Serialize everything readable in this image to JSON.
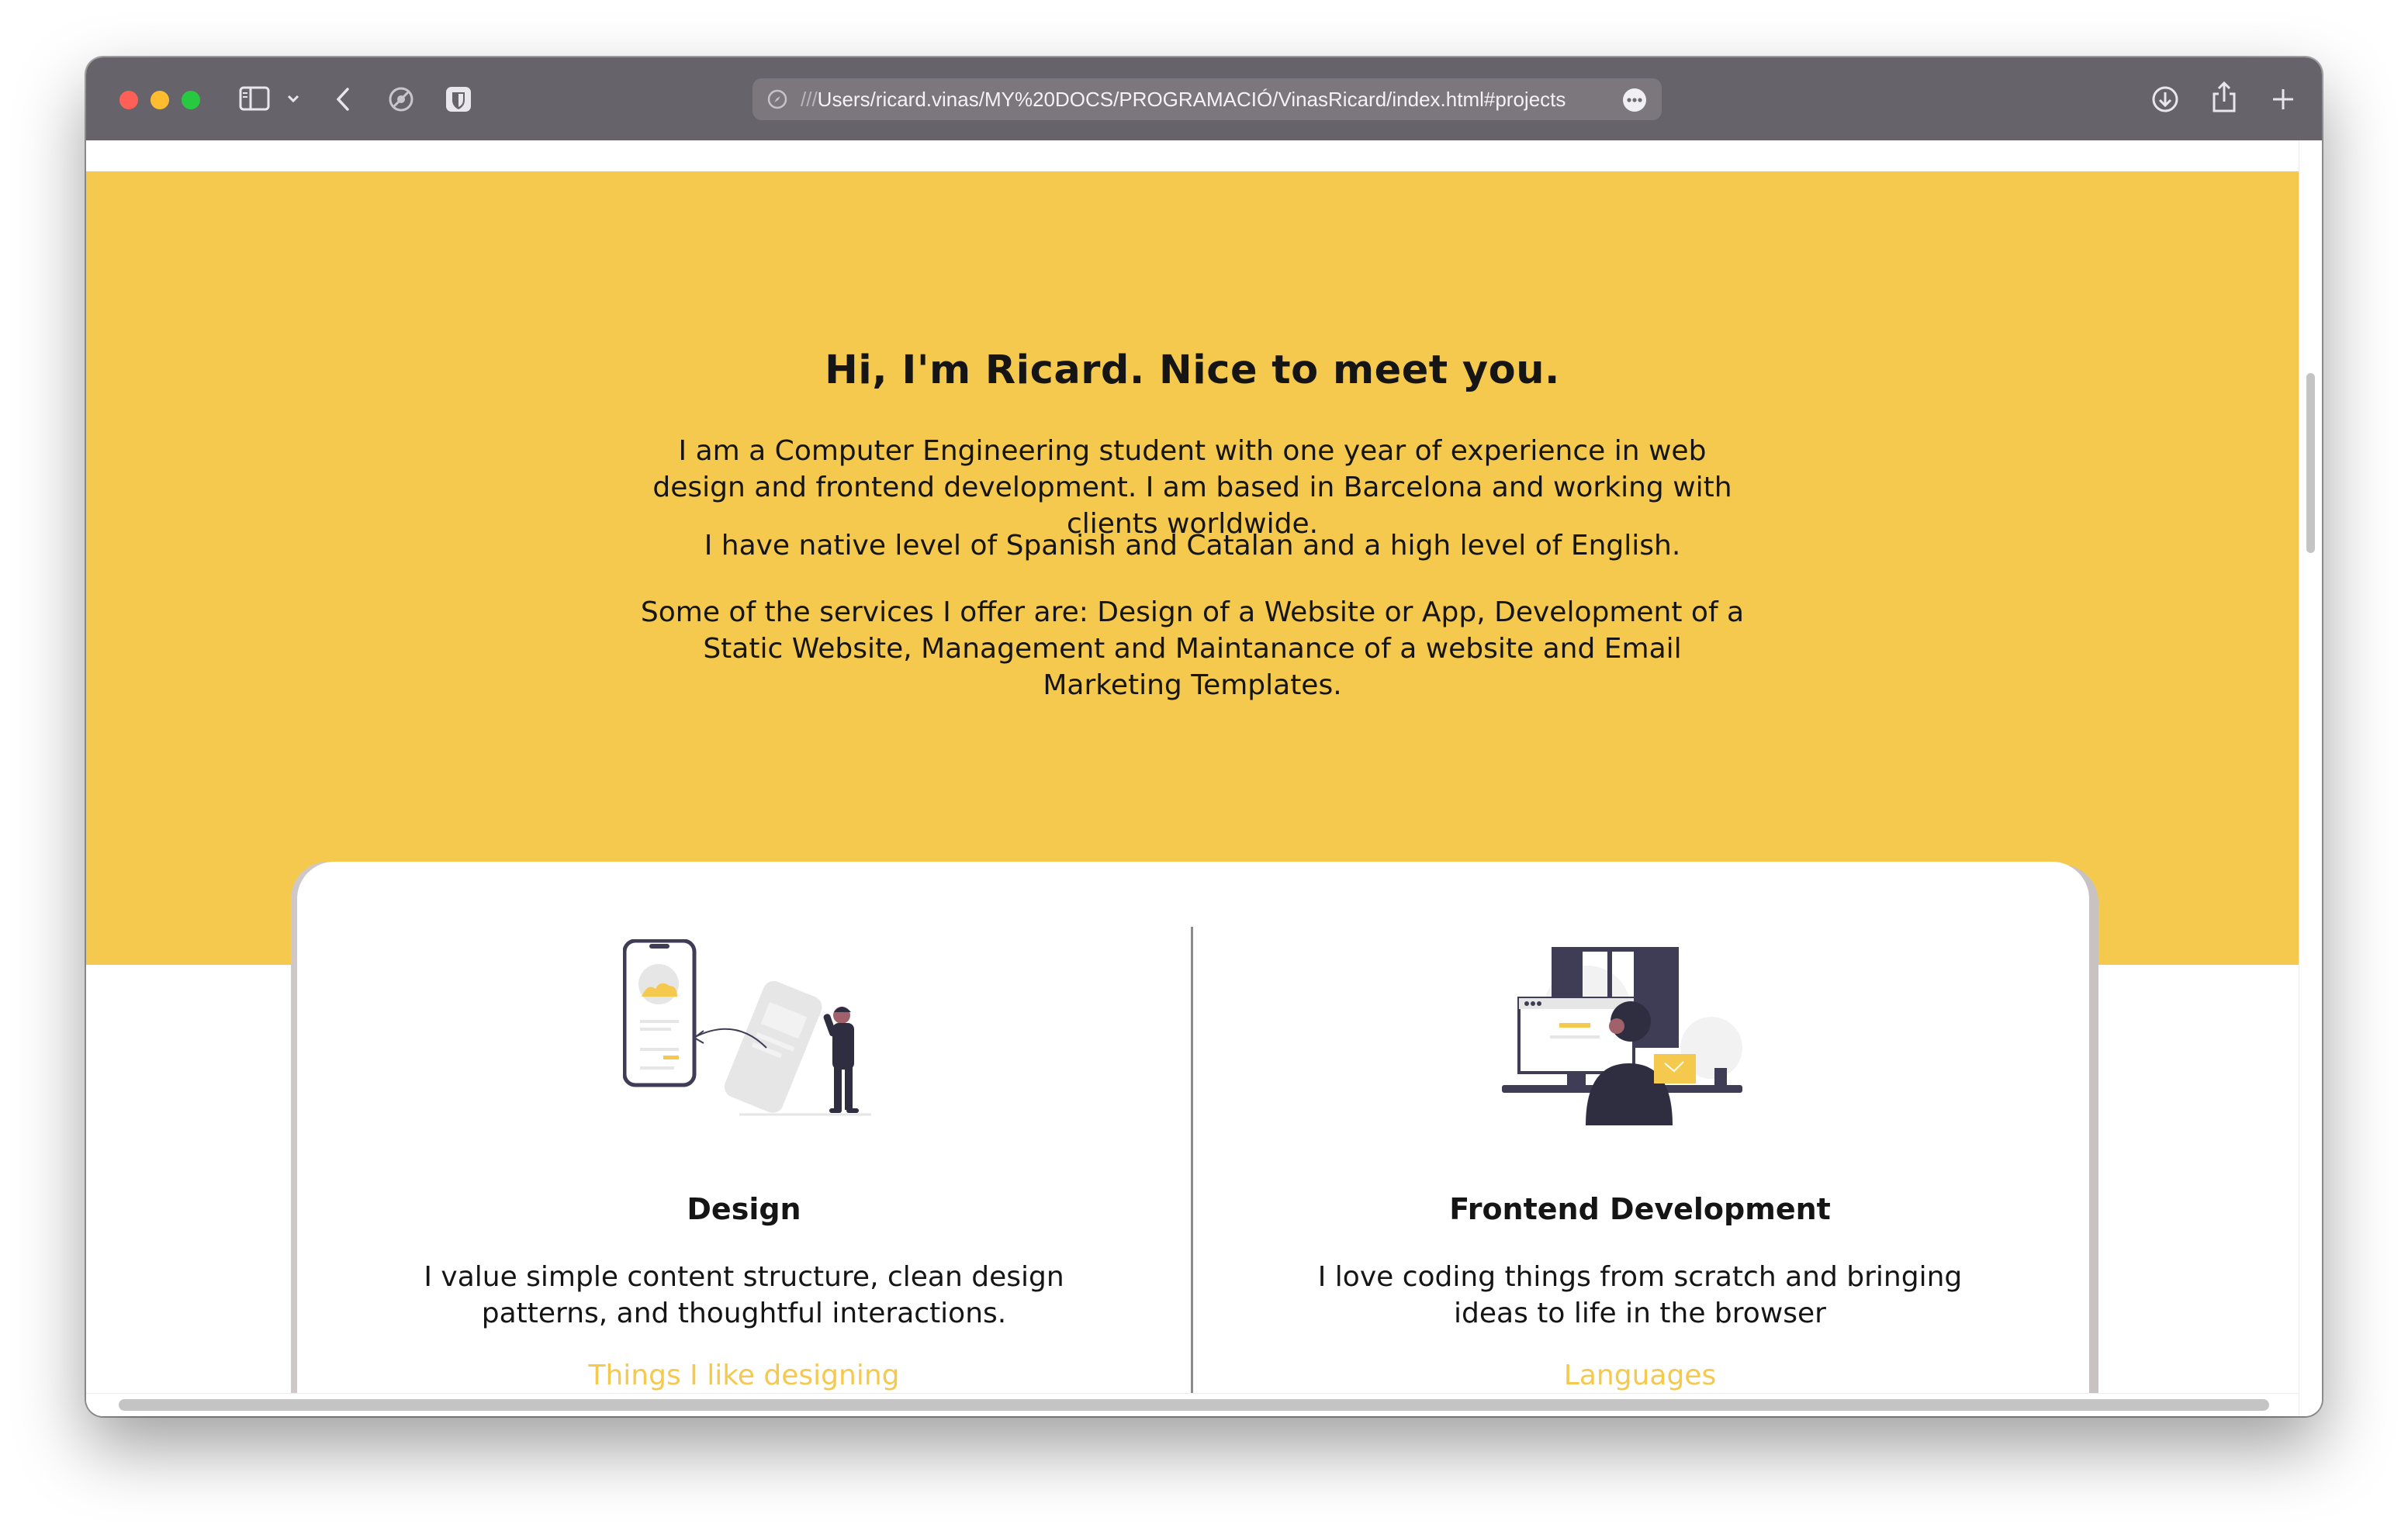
{
  "browser": {
    "url_prefix": "///",
    "url_main": "Users/ricard.vinas/MY%20DOCS/PROGRAMACIÓ/VinasRicard/index.html#projects"
  },
  "hero": {
    "title": "Hi, I'm Ricard. Nice to meet you.",
    "paragraph1": "I am a Computer Engineering student with one year of experience in web design and frontend development. I am based in Barcelona and working with clients worldwide.",
    "paragraph2": "I have native level of Spanish and Catalan and a high level of English.",
    "paragraph3": "Some of the services I offer are: Design of a Website or App, Development of a Static Website, Management and Maintanance of a website and Email Marketing Templates."
  },
  "skills": [
    {
      "title": "Design",
      "description": "I value simple content structure, clean design patterns, and thoughtful interactions.",
      "link": "Things I like designing"
    },
    {
      "title": "Frontend Development",
      "description": "I love coding things from scratch and bringing ideas to life in the browser",
      "link": "Languages"
    }
  ],
  "colors": {
    "accent": "#f4c94d",
    "text": "#151515",
    "titlebar": "#67636a"
  },
  "icons": [
    "sidebar-icon",
    "chevron-down-icon",
    "back-icon",
    "privacy-icon",
    "shield-extension-icon",
    "compass-icon",
    "more-icon",
    "download-icon",
    "share-icon",
    "new-tab-icon"
  ]
}
